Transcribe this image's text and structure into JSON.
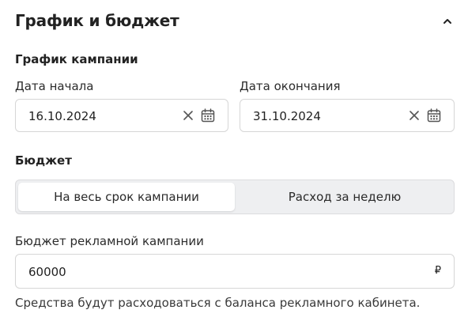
{
  "section": {
    "title": "График и бюджет",
    "collapse_icon": "chevron-up-icon"
  },
  "schedule": {
    "heading": "График кампании",
    "start": {
      "label": "Дата начала",
      "value": "16.10.2024"
    },
    "end": {
      "label": "Дата окончания",
      "value": "31.10.2024"
    }
  },
  "budget": {
    "heading": "Бюджет",
    "modes": [
      {
        "label": "На весь срок кампании",
        "selected": true
      },
      {
        "label": "Расход за неделю",
        "selected": false
      }
    ],
    "field": {
      "label": "Бюджет рекламной кампании",
      "value": "60000",
      "currency": "₽"
    },
    "hint": "Средства будут расходоваться с баланса рекламного кабинета."
  },
  "colors": {
    "text": "#222222",
    "border": "#d6d6d6",
    "segment_bg": "#eeeff1",
    "icon": "#555555"
  }
}
